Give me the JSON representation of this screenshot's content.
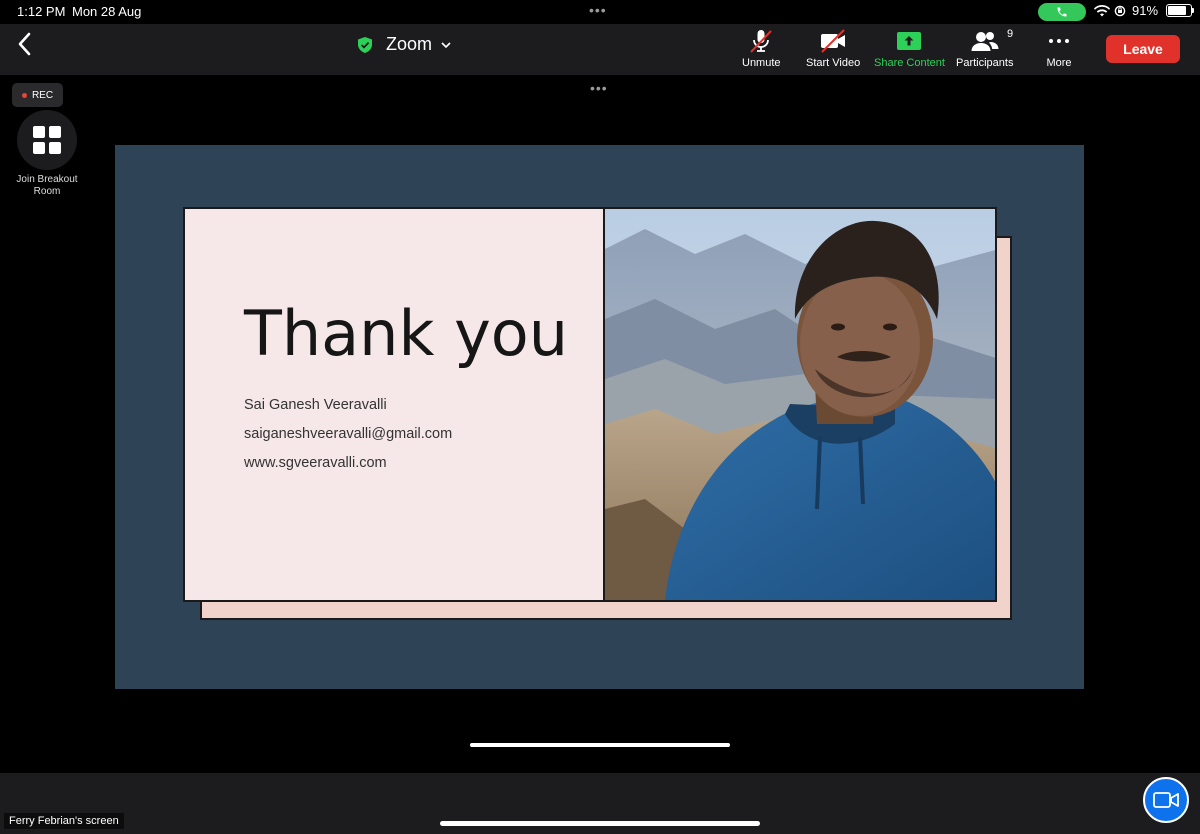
{
  "status_bar": {
    "time": "1:12 PM",
    "date": "Mon 28 Aug",
    "battery_percent": "91%",
    "battery_level": 0.91
  },
  "toolbar": {
    "meeting_title": "Zoom",
    "unmute_label": "Unmute",
    "start_video_label": "Start Video",
    "share_content_label": "Share Content",
    "participants_label": "Participants",
    "participants_count": "9",
    "more_label": "More",
    "leave_label": "Leave"
  },
  "overlays": {
    "rec_label": "REC",
    "breakout_label": "Join Breakout Room",
    "screen_owner": "Ferry Febrian's screen"
  },
  "slide": {
    "heading": "Thank you",
    "name": "Sai Ganesh Veeravalli",
    "email": "saiganeshveeravalli@gmail.com",
    "website": "www.sgveeravalli.com"
  },
  "colors": {
    "leave": "#e0322b",
    "share_green": "#2ed158",
    "slide_bg": "#2f4356",
    "card_bg": "#f6e8e8",
    "card_shadow": "#f2d3cc",
    "video_fab": "#0e72ed"
  }
}
